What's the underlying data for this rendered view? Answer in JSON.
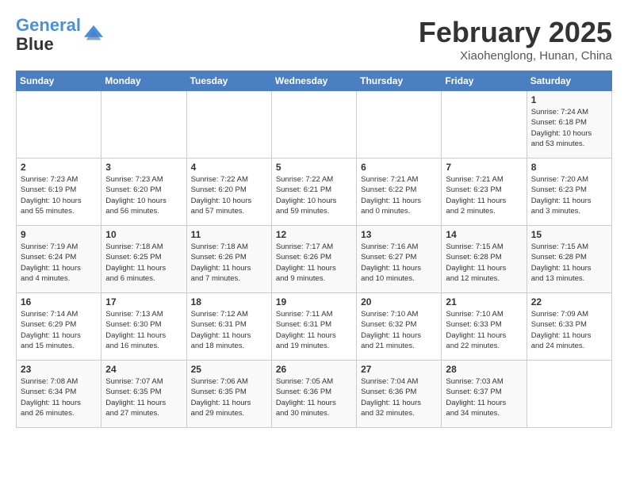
{
  "header": {
    "logo_line1": "General",
    "logo_line2": "Blue",
    "month_year": "February 2025",
    "location": "Xiaohenglong, Hunan, China"
  },
  "days_of_week": [
    "Sunday",
    "Monday",
    "Tuesday",
    "Wednesday",
    "Thursday",
    "Friday",
    "Saturday"
  ],
  "weeks": [
    [
      {
        "num": "",
        "info": ""
      },
      {
        "num": "",
        "info": ""
      },
      {
        "num": "",
        "info": ""
      },
      {
        "num": "",
        "info": ""
      },
      {
        "num": "",
        "info": ""
      },
      {
        "num": "",
        "info": ""
      },
      {
        "num": "1",
        "info": "Sunrise: 7:24 AM\nSunset: 6:18 PM\nDaylight: 10 hours\nand 53 minutes."
      }
    ],
    [
      {
        "num": "2",
        "info": "Sunrise: 7:23 AM\nSunset: 6:19 PM\nDaylight: 10 hours\nand 55 minutes."
      },
      {
        "num": "3",
        "info": "Sunrise: 7:23 AM\nSunset: 6:20 PM\nDaylight: 10 hours\nand 56 minutes."
      },
      {
        "num": "4",
        "info": "Sunrise: 7:22 AM\nSunset: 6:20 PM\nDaylight: 10 hours\nand 57 minutes."
      },
      {
        "num": "5",
        "info": "Sunrise: 7:22 AM\nSunset: 6:21 PM\nDaylight: 10 hours\nand 59 minutes."
      },
      {
        "num": "6",
        "info": "Sunrise: 7:21 AM\nSunset: 6:22 PM\nDaylight: 11 hours\nand 0 minutes."
      },
      {
        "num": "7",
        "info": "Sunrise: 7:21 AM\nSunset: 6:23 PM\nDaylight: 11 hours\nand 2 minutes."
      },
      {
        "num": "8",
        "info": "Sunrise: 7:20 AM\nSunset: 6:23 PM\nDaylight: 11 hours\nand 3 minutes."
      }
    ],
    [
      {
        "num": "9",
        "info": "Sunrise: 7:19 AM\nSunset: 6:24 PM\nDaylight: 11 hours\nand 4 minutes."
      },
      {
        "num": "10",
        "info": "Sunrise: 7:18 AM\nSunset: 6:25 PM\nDaylight: 11 hours\nand 6 minutes."
      },
      {
        "num": "11",
        "info": "Sunrise: 7:18 AM\nSunset: 6:26 PM\nDaylight: 11 hours\nand 7 minutes."
      },
      {
        "num": "12",
        "info": "Sunrise: 7:17 AM\nSunset: 6:26 PM\nDaylight: 11 hours\nand 9 minutes."
      },
      {
        "num": "13",
        "info": "Sunrise: 7:16 AM\nSunset: 6:27 PM\nDaylight: 11 hours\nand 10 minutes."
      },
      {
        "num": "14",
        "info": "Sunrise: 7:15 AM\nSunset: 6:28 PM\nDaylight: 11 hours\nand 12 minutes."
      },
      {
        "num": "15",
        "info": "Sunrise: 7:15 AM\nSunset: 6:28 PM\nDaylight: 11 hours\nand 13 minutes."
      }
    ],
    [
      {
        "num": "16",
        "info": "Sunrise: 7:14 AM\nSunset: 6:29 PM\nDaylight: 11 hours\nand 15 minutes."
      },
      {
        "num": "17",
        "info": "Sunrise: 7:13 AM\nSunset: 6:30 PM\nDaylight: 11 hours\nand 16 minutes."
      },
      {
        "num": "18",
        "info": "Sunrise: 7:12 AM\nSunset: 6:31 PM\nDaylight: 11 hours\nand 18 minutes."
      },
      {
        "num": "19",
        "info": "Sunrise: 7:11 AM\nSunset: 6:31 PM\nDaylight: 11 hours\nand 19 minutes."
      },
      {
        "num": "20",
        "info": "Sunrise: 7:10 AM\nSunset: 6:32 PM\nDaylight: 11 hours\nand 21 minutes."
      },
      {
        "num": "21",
        "info": "Sunrise: 7:10 AM\nSunset: 6:33 PM\nDaylight: 11 hours\nand 22 minutes."
      },
      {
        "num": "22",
        "info": "Sunrise: 7:09 AM\nSunset: 6:33 PM\nDaylight: 11 hours\nand 24 minutes."
      }
    ],
    [
      {
        "num": "23",
        "info": "Sunrise: 7:08 AM\nSunset: 6:34 PM\nDaylight: 11 hours\nand 26 minutes."
      },
      {
        "num": "24",
        "info": "Sunrise: 7:07 AM\nSunset: 6:35 PM\nDaylight: 11 hours\nand 27 minutes."
      },
      {
        "num": "25",
        "info": "Sunrise: 7:06 AM\nSunset: 6:35 PM\nDaylight: 11 hours\nand 29 minutes."
      },
      {
        "num": "26",
        "info": "Sunrise: 7:05 AM\nSunset: 6:36 PM\nDaylight: 11 hours\nand 30 minutes."
      },
      {
        "num": "27",
        "info": "Sunrise: 7:04 AM\nSunset: 6:36 PM\nDaylight: 11 hours\nand 32 minutes."
      },
      {
        "num": "28",
        "info": "Sunrise: 7:03 AM\nSunset: 6:37 PM\nDaylight: 11 hours\nand 34 minutes."
      },
      {
        "num": "",
        "info": ""
      }
    ]
  ]
}
